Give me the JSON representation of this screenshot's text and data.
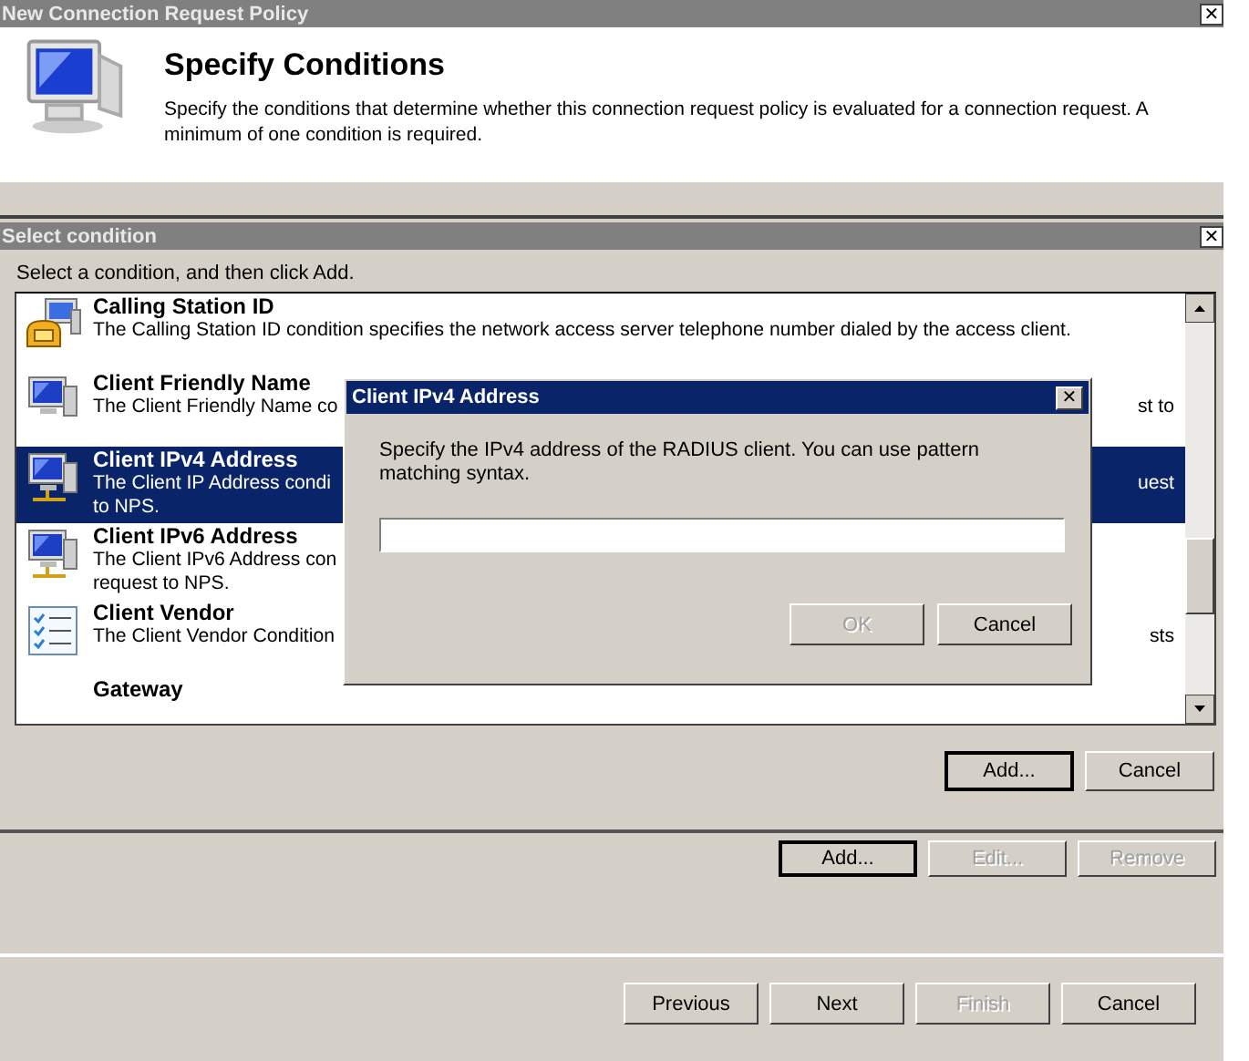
{
  "window": {
    "title": "New Connection Request Policy",
    "close": "✕"
  },
  "header": {
    "title": "Specify Conditions",
    "description": "Specify the conditions that determine whether this connection request policy is evaluated for a connection request. A minimum of one condition is required."
  },
  "select_condition": {
    "title": "Select condition",
    "close": "✕",
    "instruction": "Select a condition, and then click Add.",
    "items": [
      {
        "kind": "phone-computer",
        "title": "Calling Station ID",
        "selected": false,
        "lines": [
          {
            "left": "The Calling Station ID condition specifies the network access server telephone number dialed by the access client."
          }
        ]
      },
      {
        "kind": "computer",
        "title": "Client Friendly Name",
        "selected": false,
        "lines": [
          {
            "left": "The Client Friendly Name co",
            "right": "st to"
          }
        ]
      },
      {
        "kind": "network-computer",
        "title": "Client IPv4 Address",
        "selected": true,
        "lines": [
          {
            "left": "The Client IP Address condi",
            "right": "uest"
          },
          {
            "left": "to NPS."
          }
        ]
      },
      {
        "kind": "network-computer",
        "title": "Client IPv6 Address",
        "selected": false,
        "lines": [
          {
            "left": "The Client IPv6 Address con"
          },
          {
            "left": "request to NPS."
          }
        ]
      },
      {
        "kind": "checklist",
        "title": "Client Vendor",
        "selected": false,
        "lines": [
          {
            "left": "The Client Vendor Condition",
            "right": "sts"
          }
        ]
      },
      {
        "kind": "none",
        "title": "Gateway",
        "selected": false
      }
    ],
    "buttons": [
      {
        "label": "Add...",
        "disabled": false,
        "default": true
      },
      {
        "label": "Cancel",
        "disabled": false,
        "default": false
      }
    ]
  },
  "conditions_buttons": [
    {
      "label": "Add...",
      "disabled": false,
      "default": true
    },
    {
      "label": "Edit...",
      "disabled": true,
      "default": false
    },
    {
      "label": "Remove",
      "disabled": true,
      "default": false
    }
  ],
  "wizard_buttons": [
    {
      "label": "Previous",
      "disabled": false,
      "default": false
    },
    {
      "label": "Next",
      "disabled": false,
      "default": false
    },
    {
      "label": "Finish",
      "disabled": true,
      "default": false
    },
    {
      "label": "Cancel",
      "disabled": false,
      "default": false
    }
  ],
  "ipv4_dialog": {
    "title": "Client IPv4 Address",
    "close": "✕",
    "description": "Specify the IPv4 address of the RADIUS client. You can use pattern matching syntax.",
    "buttons": [
      {
        "label": "OK",
        "disabled": true,
        "default": false
      },
      {
        "label": "Cancel",
        "disabled": false,
        "default": false
      }
    ]
  }
}
